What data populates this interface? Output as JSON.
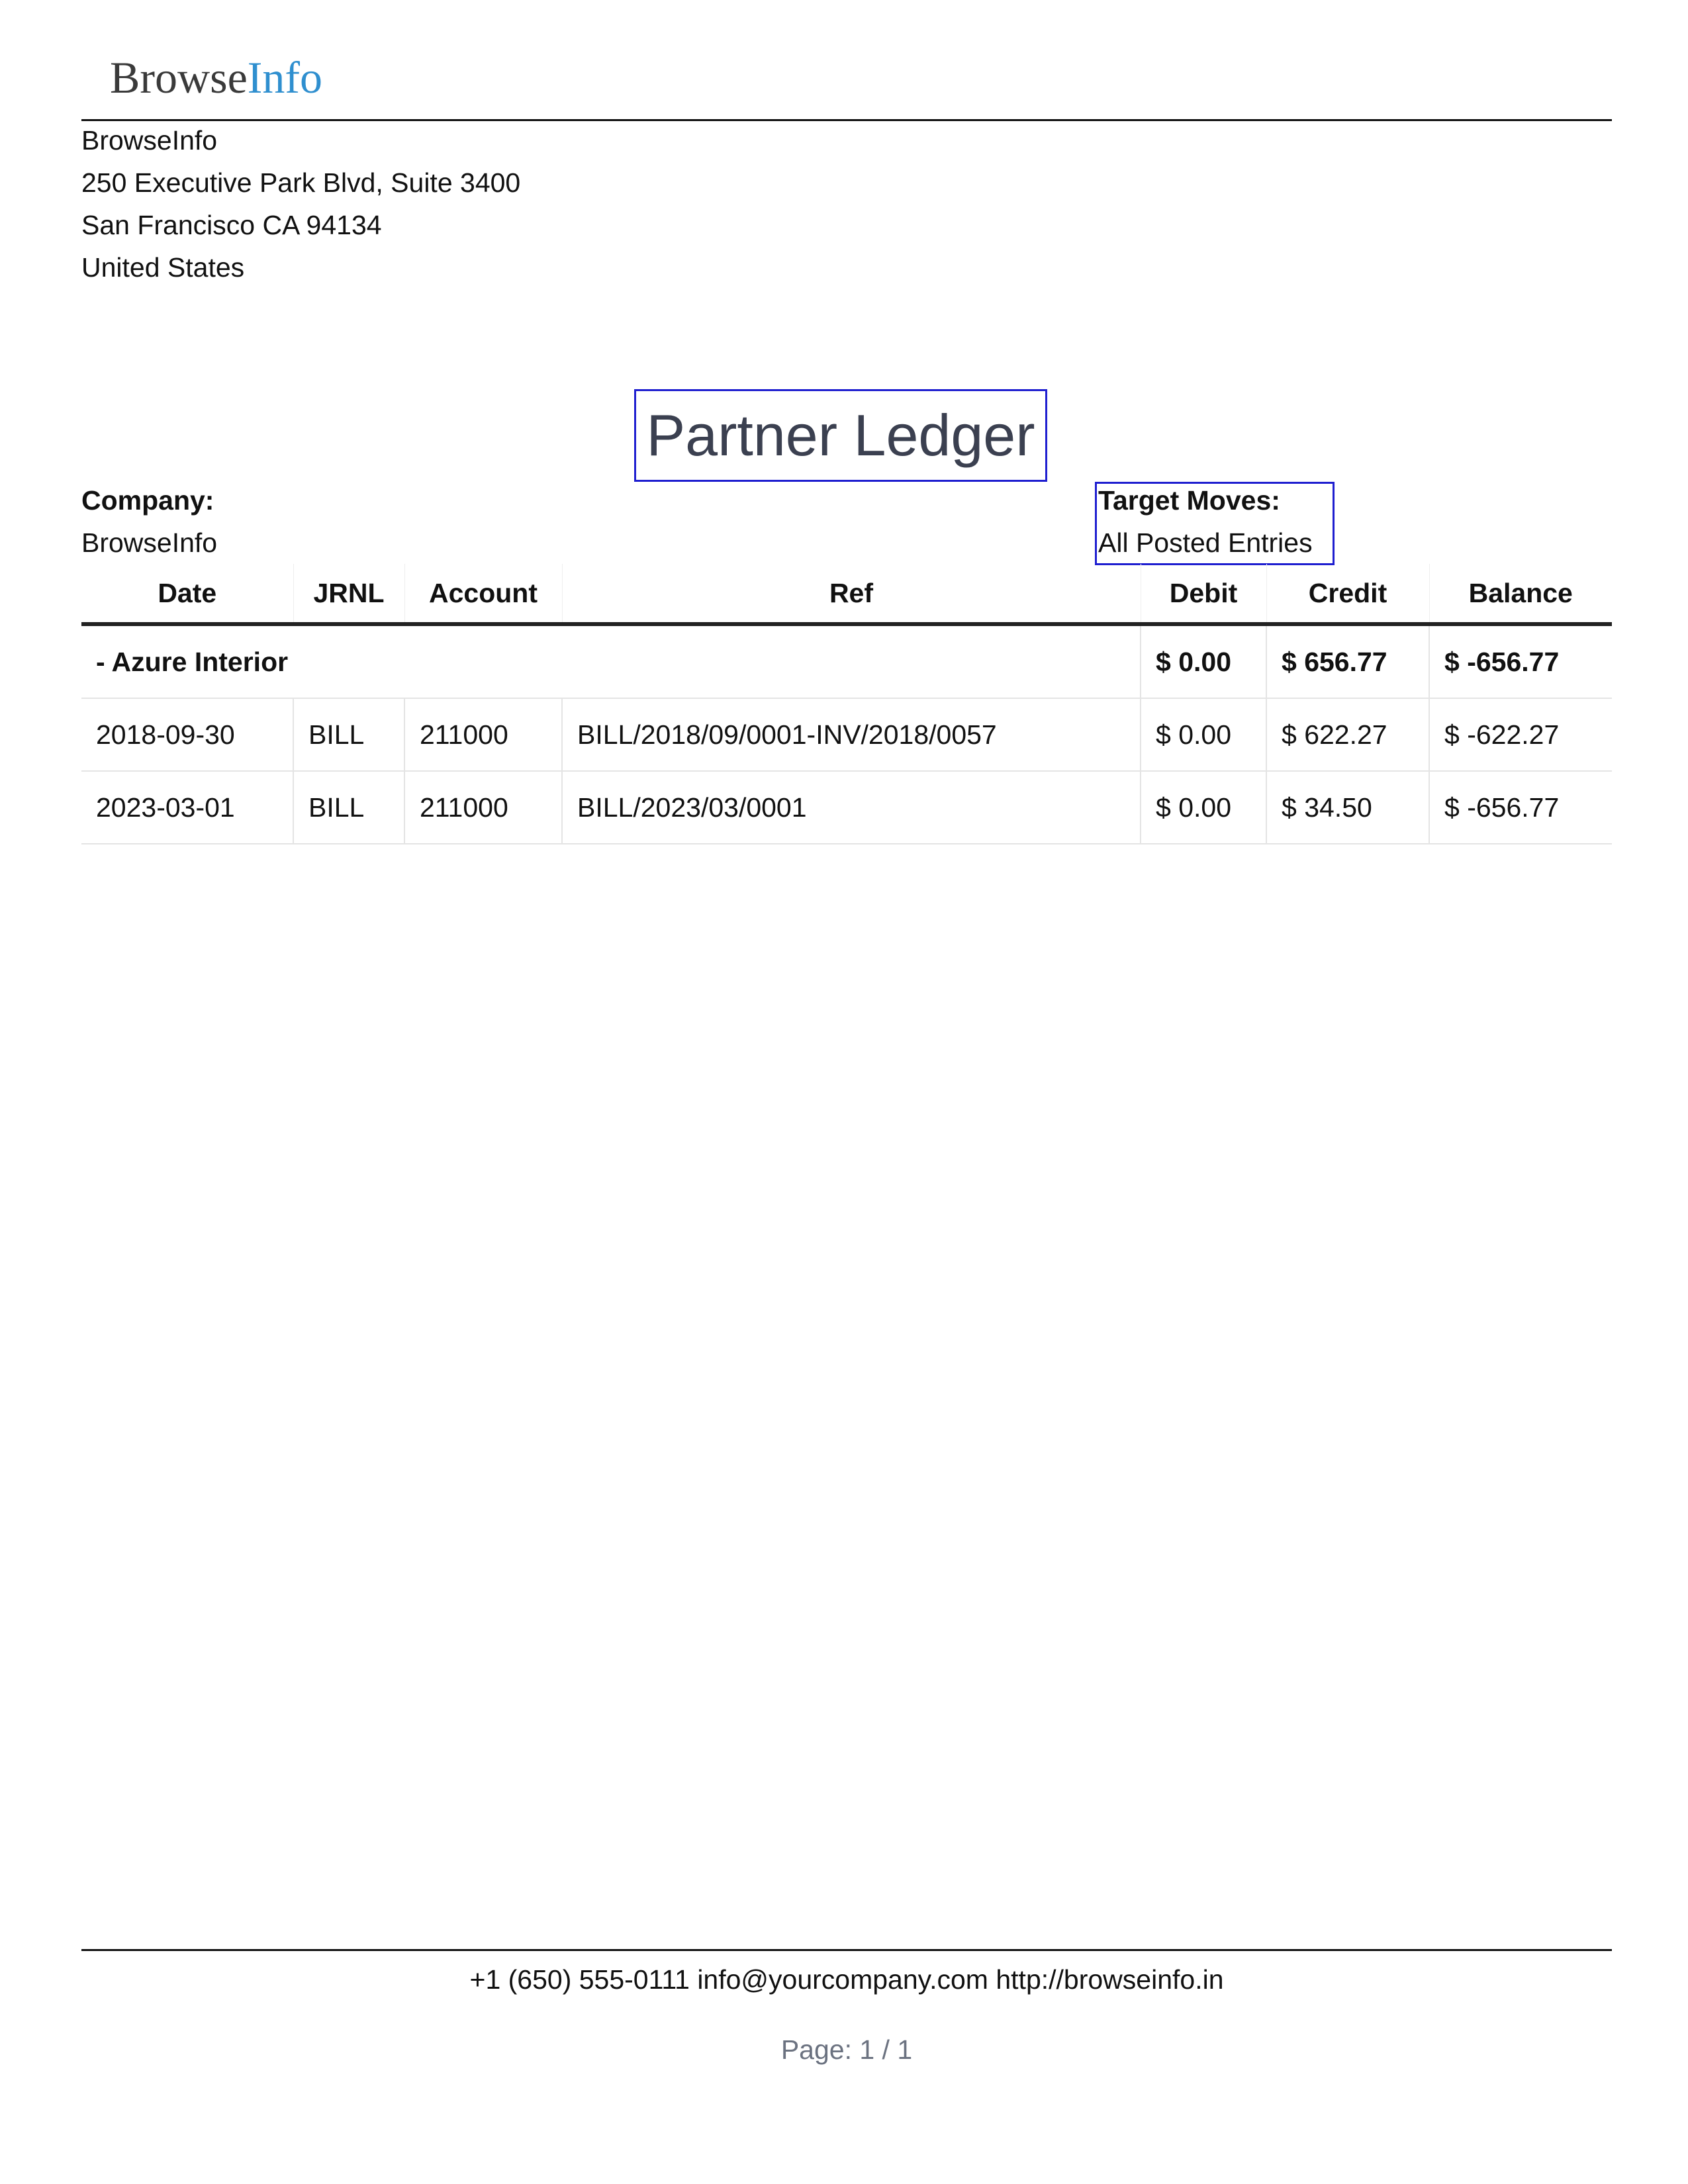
{
  "logo": {
    "part1": "Browse",
    "part2": "Info"
  },
  "company_address": {
    "name": "BrowseInfo",
    "street": "250 Executive Park Blvd, Suite 3400",
    "city_line": "San Francisco CA 94134",
    "country": "United States"
  },
  "report": {
    "title": "Partner Ledger",
    "company_label": "Company:",
    "company_value": "BrowseInfo",
    "target_label": "Target Moves:",
    "target_value": "All Posted Entries"
  },
  "table": {
    "headers": [
      "Date",
      "JRNL",
      "Account",
      "Ref",
      "Debit",
      "Credit",
      "Balance"
    ],
    "partner": {
      "name": "- Azure Interior",
      "debit": "$ 0.00",
      "credit": "$ 656.77",
      "balance": "$ -656.77"
    },
    "rows": [
      {
        "date": "2018-09-30",
        "jrnl": "BILL",
        "account": "211000",
        "ref": "BILL/2018/09/0001-INV/2018/0057",
        "debit": "$ 0.00",
        "credit": "$ 622.27",
        "balance": "$ -622.27"
      },
      {
        "date": "2023-03-01",
        "jrnl": "BILL",
        "account": "211000",
        "ref": "BILL/2023/03/0001",
        "debit": "$ 0.00",
        "credit": "$ 34.50",
        "balance": "$ -656.77"
      }
    ]
  },
  "footer": {
    "contact": "+1 (650) 555-0111 info@yourcompany.com http://browseinfo.in",
    "page": "Page: 1 / 1"
  },
  "colors": {
    "logo_accent": "#2f8fcf",
    "highlight_box": "#1f1fd0",
    "title_text": "#3b4050"
  }
}
